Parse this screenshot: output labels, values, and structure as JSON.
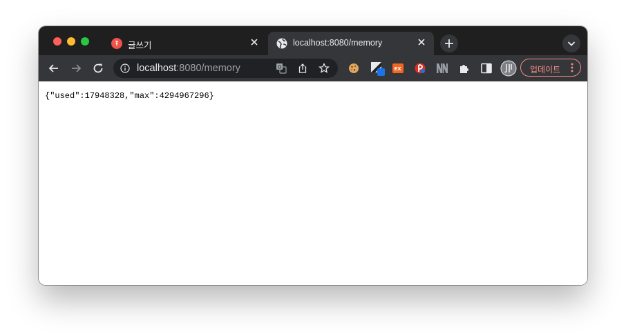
{
  "tabs": [
    {
      "title": "글쓰기",
      "active": false,
      "favicon": "red-circle-icon"
    },
    {
      "title": "localhost:8080/memory",
      "active": true,
      "favicon": "globe-icon"
    }
  ],
  "omnibox": {
    "host": "localhost",
    "rest": ":8080/memory"
  },
  "toolbar": {
    "update_label": "업데이트"
  },
  "page": {
    "body_text": "{\"used\":17948328,\"max\":4294967296}"
  },
  "colors": {
    "tabstrip_bg": "#1f1f1f",
    "toolbar_bg": "#35363a",
    "omnibox_bg": "#202124",
    "update_accent": "#f28b82"
  }
}
